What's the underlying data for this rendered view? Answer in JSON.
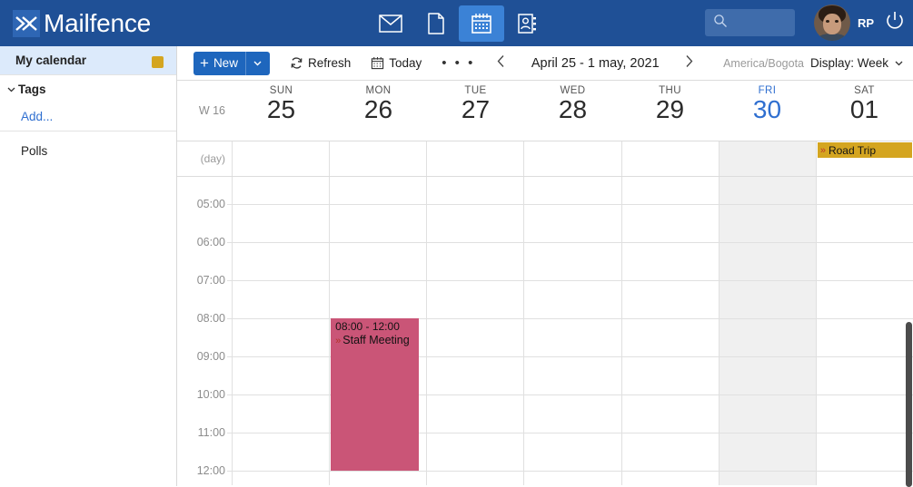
{
  "app": {
    "brand": "Mailfence",
    "brand_mark_icon": "mailfence-logo-icon",
    "topbar_color": "#1f5096",
    "accent_color": "#1e66bd"
  },
  "topnav": {
    "items": [
      {
        "name": "mail-icon",
        "label": "Messages",
        "active": false
      },
      {
        "name": "documents-icon",
        "label": "Documents",
        "active": false
      },
      {
        "name": "calendar-icon",
        "label": "Calendar",
        "active": true
      },
      {
        "name": "contacts-icon",
        "label": "Contacts",
        "active": false
      }
    ],
    "search": {
      "value": "",
      "placeholder": "",
      "icon": "search-icon"
    },
    "user": {
      "initials": "RP",
      "avatar_icon": "user-avatar"
    },
    "power": {
      "icon": "power-icon",
      "label": "Log out"
    }
  },
  "sidebar": {
    "calendar": {
      "label": "My calendar",
      "swatch_color": "#d4a520"
    },
    "tags": {
      "label": "Tags",
      "chevron": "chevron-down-icon"
    },
    "add": {
      "label": "Add..."
    },
    "polls": {
      "label": "Polls"
    }
  },
  "toolbar": {
    "new_label": "New",
    "new_plus": "+",
    "refresh_label": "Refresh",
    "today_label": "Today",
    "more_label": "• • •",
    "prev_label": "‹",
    "next_label": "›",
    "date_range": "April 25 - 1 may, 2021",
    "timezone": "America/Bogota",
    "display_label": "Display: Week"
  },
  "calendar": {
    "week_label": "W 16",
    "allday_label": "(day)",
    "days": [
      {
        "dow": "SUN",
        "num": "25",
        "today": false,
        "shaded": false
      },
      {
        "dow": "MON",
        "num": "26",
        "today": false,
        "shaded": false
      },
      {
        "dow": "TUE",
        "num": "27",
        "today": false,
        "shaded": false
      },
      {
        "dow": "WED",
        "num": "28",
        "today": false,
        "shaded": false
      },
      {
        "dow": "THU",
        "num": "29",
        "today": false,
        "shaded": false
      },
      {
        "dow": "FRI",
        "num": "30",
        "today": true,
        "shaded": true
      },
      {
        "dow": "SAT",
        "num": "01",
        "today": false,
        "shaded": false
      }
    ],
    "time_labels": [
      "05:00",
      "06:00",
      "07:00",
      "08:00",
      "09:00",
      "10:00",
      "11:00",
      "12:00"
    ],
    "allday_events": [
      {
        "title": "Road Trip",
        "day_index": 6,
        "marker": "»",
        "color": "#d4a520"
      }
    ],
    "events": [
      {
        "time": "08:00 - 12:00",
        "title": "Staff Meeting",
        "marker": "»",
        "day_index": 1,
        "color": "#ca5577",
        "start_hour": "08:00",
        "end_hour": "12:00"
      }
    ]
  }
}
